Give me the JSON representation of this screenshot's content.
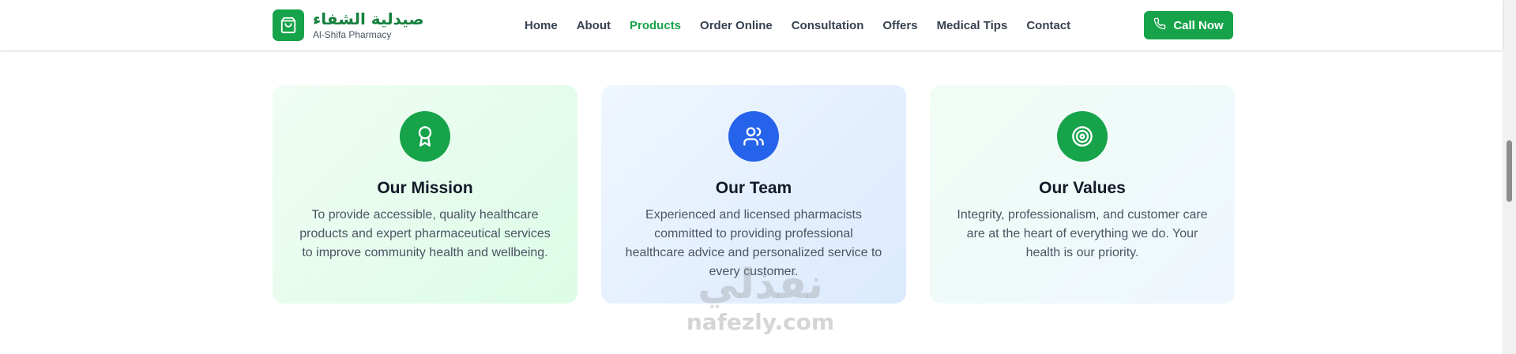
{
  "brand": {
    "name_ar": "صيدلية الشفاء",
    "name_en": "Al-Shifa Pharmacy",
    "logo_icon": "shopping-bag-icon",
    "color": "#16a34a"
  },
  "nav": {
    "items": [
      {
        "label": "Home"
      },
      {
        "label": "About"
      },
      {
        "label": "Products",
        "active": true
      },
      {
        "label": "Order Online"
      },
      {
        "label": "Consultation"
      },
      {
        "label": "Offers"
      },
      {
        "label": "Medical Tips"
      },
      {
        "label": "Contact"
      }
    ],
    "active_color": "#16a34a"
  },
  "call_button": {
    "label": "Call Now",
    "icon": "phone-icon",
    "color": "#16a34a"
  },
  "cards": [
    {
      "title": "Our Mission",
      "text": "To provide accessible, quality healthcare products and expert pharmaceutical services to improve community health and wellbeing.",
      "icon": "award-icon",
      "icon_color": "#16a34a"
    },
    {
      "title": "Our Team",
      "text": "Experienced and licensed pharmacists committed to providing professional healthcare advice and personalized service to every customer.",
      "icon": "users-icon",
      "icon_color": "#2563eb"
    },
    {
      "title": "Our Values",
      "text": "Integrity, professionalism, and customer care are at the heart of everything we do. Your health is our priority.",
      "icon": "target-icon",
      "icon_color": "#16a34a"
    }
  ],
  "watermark": {
    "text_ar": "نفذلي",
    "text_en": "nafezly.com"
  }
}
